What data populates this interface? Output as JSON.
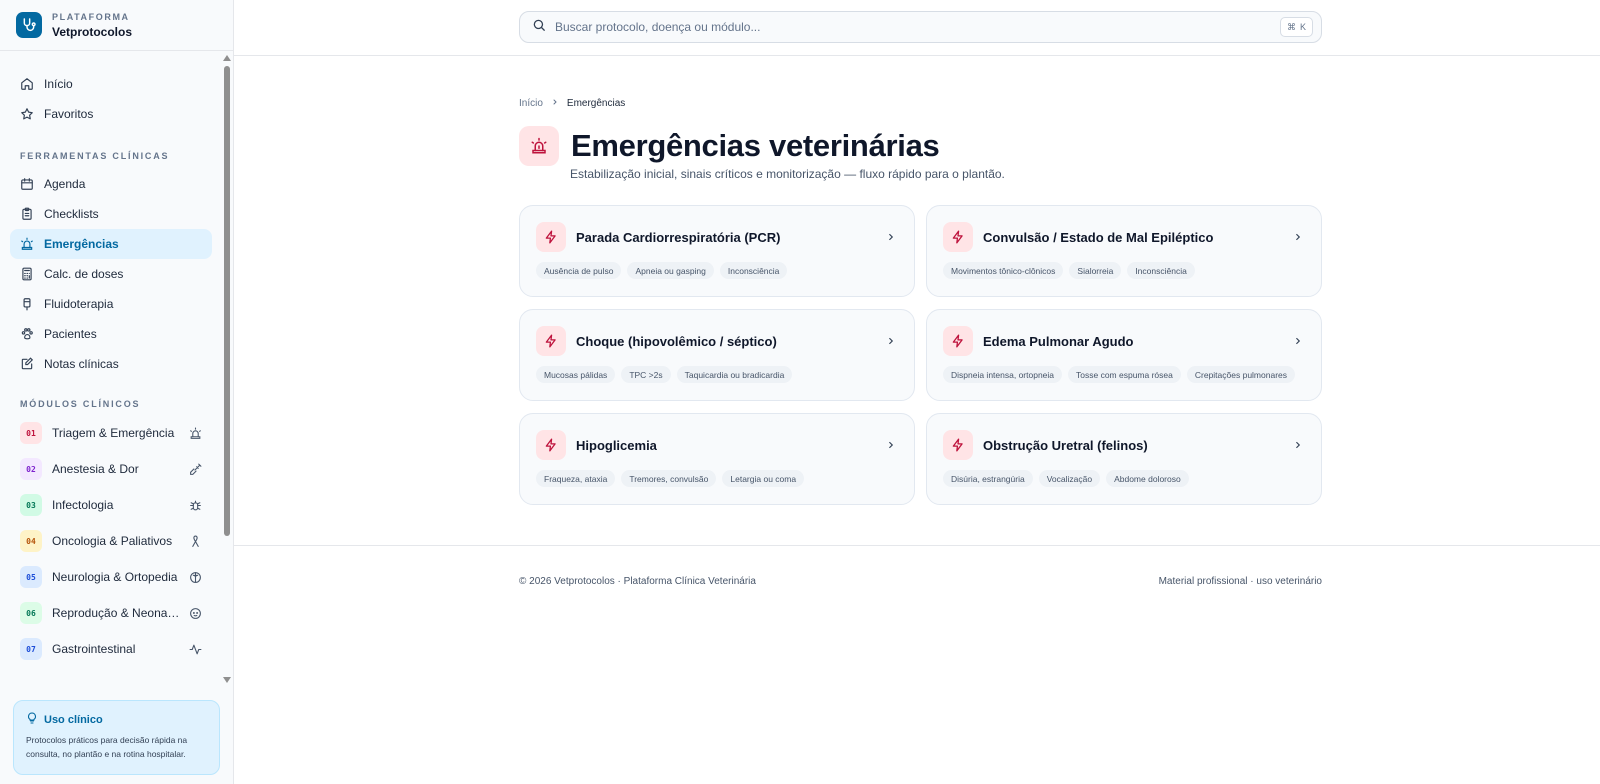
{
  "brand": {
    "eyebrow": "PLATAFORMA",
    "name": "Vetprotocolos"
  },
  "colors": {
    "accent": "#0369a1",
    "danger": "#be123c",
    "danger_bg": "#ffe4e6"
  },
  "nav": {
    "items": [
      {
        "label": "Início",
        "icon": "home-icon"
      },
      {
        "label": "Favoritos",
        "icon": "star-icon"
      }
    ],
    "tools_label": "FERRAMENTAS CLÍNICAS",
    "tools": [
      {
        "label": "Agenda",
        "icon": "calendar-icon"
      },
      {
        "label": "Checklists",
        "icon": "clipboard-icon"
      },
      {
        "label": "Emergências",
        "icon": "siren-icon",
        "active": true
      },
      {
        "label": "Calc. de doses",
        "icon": "calculator-icon"
      },
      {
        "label": "Fluidoterapia",
        "icon": "iv-bag-icon"
      },
      {
        "label": "Pacientes",
        "icon": "paw-icon"
      },
      {
        "label": "Notas clínicas",
        "icon": "note-edit-icon"
      }
    ],
    "modules_label": "MÓDULOS CLÍNICOS",
    "modules": [
      {
        "num": "01",
        "label": "Triagem & Emergência",
        "icon": "siren-icon",
        "color": "#be123c",
        "bg": "#ffe4e6"
      },
      {
        "num": "02",
        "label": "Anestesia & Dor",
        "icon": "syringe-icon",
        "color": "#7e22ce",
        "bg": "#f3e8ff"
      },
      {
        "num": "03",
        "label": "Infectologia",
        "icon": "bug-icon",
        "color": "#047857",
        "bg": "#d1fae5"
      },
      {
        "num": "04",
        "label": "Oncologia & Paliativos",
        "icon": "ribbon-icon",
        "color": "#b45309",
        "bg": "#fef3c7"
      },
      {
        "num": "05",
        "label": "Neurologia & Ortopedia",
        "icon": "brain-icon",
        "color": "#1d4ed8",
        "bg": "#dbeafe"
      },
      {
        "num": "06",
        "label": "Reprodução & Neonatologia",
        "icon": "baby-icon",
        "color": "#047857",
        "bg": "#dcfce7"
      },
      {
        "num": "07",
        "label": "Gastrointestinal",
        "icon": "activity-icon",
        "color": "#1d4ed8",
        "bg": "#dbeafe"
      }
    ]
  },
  "usage": {
    "title": "Uso clínico",
    "text": "Protocolos práticos para decisão rápida na consulta, no plantão e na rotina hospitalar."
  },
  "search": {
    "placeholder": "Buscar protocolo, doença ou módulo...",
    "value": "",
    "shortcut_symbol": "⌘",
    "shortcut_key": "K"
  },
  "breadcrumb": {
    "home": "Início",
    "current": "Emergências"
  },
  "page": {
    "title": "Emergências veterinárias",
    "subtitle": "Estabilização inicial, sinais críticos e monitorização — fluxo rápido para o plantão."
  },
  "cards": [
    {
      "title": "Parada Cardiorrespiratória (PCR)",
      "tags": [
        "Ausência de pulso",
        "Apneia ou gasping",
        "Inconsciência"
      ]
    },
    {
      "title": "Convulsão / Estado de Mal Epiléptico",
      "tags": [
        "Movimentos tônico-clônicos",
        "Sialorreia",
        "Inconsciência"
      ]
    },
    {
      "title": "Choque (hipovolêmico / séptico)",
      "tags": [
        "Mucosas pálidas",
        "TPC >2s",
        "Taquicardia ou bradicardia"
      ]
    },
    {
      "title": "Edema Pulmonar Agudo",
      "tags": [
        "Dispneia intensa, ortopneia",
        "Tosse com espuma rósea",
        "Crepitações pulmonares"
      ]
    },
    {
      "title": "Hipoglicemia",
      "tags": [
        "Fraqueza, ataxia",
        "Tremores, convulsão",
        "Letargia ou coma"
      ]
    },
    {
      "title": "Obstrução Uretral (felinos)",
      "tags": [
        "Disúria, estrangúria",
        "Vocalização",
        "Abdome doloroso"
      ]
    }
  ],
  "footer": {
    "left": "© 2026 Vetprotocolos · Plataforma Clínica Veterinária",
    "right": "Material profissional · uso veterinário"
  }
}
